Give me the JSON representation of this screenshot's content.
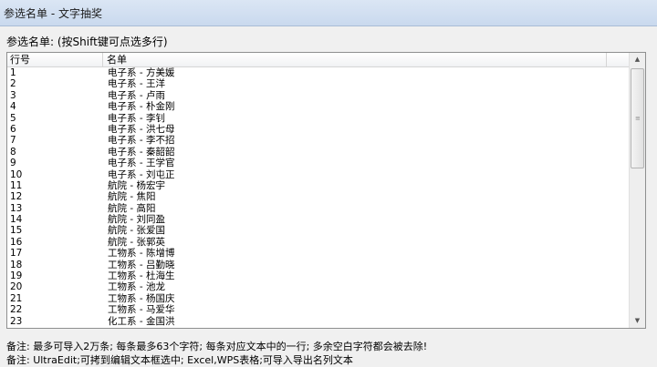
{
  "window": {
    "title": "参选名单 - 文字抽奖"
  },
  "header": {
    "label": "参选名单: (按Shift键可点选多行)"
  },
  "list": {
    "columns": [
      "行号",
      "名单"
    ],
    "rows": [
      {
        "no": "1",
        "name": "电子系 - 方美媛"
      },
      {
        "no": "2",
        "name": "电子系 - 王洋"
      },
      {
        "no": "3",
        "name": "电子系 - 卢雨"
      },
      {
        "no": "4",
        "name": "电子系 - 朴金刚"
      },
      {
        "no": "5",
        "name": "电子系 - 李钊"
      },
      {
        "no": "6",
        "name": "电子系 - 洪七母"
      },
      {
        "no": "7",
        "name": "电子系 - 李不招"
      },
      {
        "no": "8",
        "name": "电子系 - 秦韶韶"
      },
      {
        "no": "9",
        "name": "电子系 - 王学官"
      },
      {
        "no": "10",
        "name": "电子系 - 刘屯正"
      },
      {
        "no": "11",
        "name": "航院 - 杨宏宇"
      },
      {
        "no": "12",
        "name": "航院 - 焦阳"
      },
      {
        "no": "13",
        "name": "航院 - 高阳"
      },
      {
        "no": "14",
        "name": "航院 - 刘同盈"
      },
      {
        "no": "15",
        "name": "航院 - 张爱国"
      },
      {
        "no": "16",
        "name": "航院 - 张郭英"
      },
      {
        "no": "17",
        "name": "工物系 - 陈增博"
      },
      {
        "no": "18",
        "name": "工物系 - 吕勤晓"
      },
      {
        "no": "19",
        "name": "工物系 - 杜海生"
      },
      {
        "no": "20",
        "name": "工物系 - 池龙"
      },
      {
        "no": "21",
        "name": "工物系 - 杨国庆"
      },
      {
        "no": "22",
        "name": "工物系 - 马爱华"
      },
      {
        "no": "23",
        "name": "化工系 - 金国洪"
      }
    ]
  },
  "scrollbar": {
    "up_glyph": "▲",
    "down_glyph": "▼",
    "grip_glyph": "≡"
  },
  "notes": {
    "line1": "备注: 最多可导入2万条; 每条最多63个字符; 每条对应文本中的一行; 多余空白字符都会被去除!",
    "line2": "备注: UltraEdit;可拷到编辑文本框选中; Excel,WPS表格;可导入导出名列文本"
  }
}
